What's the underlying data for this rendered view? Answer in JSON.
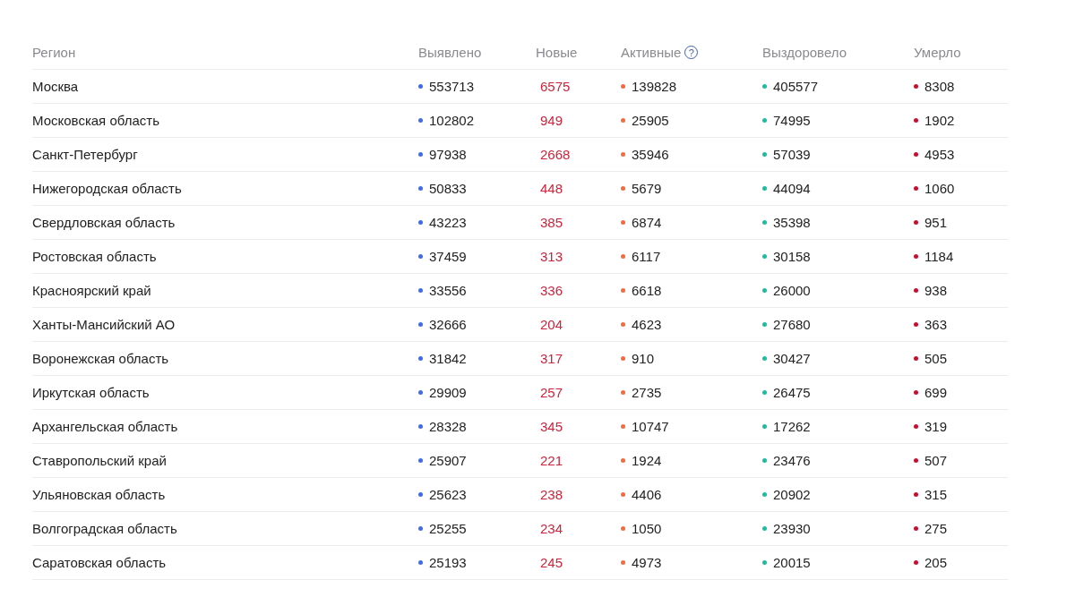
{
  "table": {
    "columns": [
      {
        "label": "Регион",
        "kind": "name"
      },
      {
        "label": "Выявлено",
        "kind": "dot",
        "color": "#3d6cf2"
      },
      {
        "label": "Новые",
        "kind": "new"
      },
      {
        "label": "Активные",
        "kind": "dot",
        "color": "#f36b3f",
        "help": "?"
      },
      {
        "label": "Выздоровело",
        "kind": "dot",
        "color": "#17bfa0"
      },
      {
        "label": "Умерло",
        "kind": "dot",
        "color": "#c8102e"
      }
    ],
    "rows": [
      [
        "Москва",
        "553713",
        "6575",
        "139828",
        "405577",
        "8308"
      ],
      [
        "Московская область",
        "102802",
        "949",
        "25905",
        "74995",
        "1902"
      ],
      [
        "Санкт-Петербург",
        "97938",
        "2668",
        "35946",
        "57039",
        "4953"
      ],
      [
        "Нижегородская область",
        "50833",
        "448",
        "5679",
        "44094",
        "1060"
      ],
      [
        "Свердловская область",
        "43223",
        "385",
        "6874",
        "35398",
        "951"
      ],
      [
        "Ростовская область",
        "37459",
        "313",
        "6117",
        "30158",
        "1184"
      ],
      [
        "Красноярский край",
        "33556",
        "336",
        "6618",
        "26000",
        "938"
      ],
      [
        "Ханты-Мансийский АО",
        "32666",
        "204",
        "4623",
        "27680",
        "363"
      ],
      [
        "Воронежская область",
        "31842",
        "317",
        "910",
        "30427",
        "505"
      ],
      [
        "Иркутская область",
        "29909",
        "257",
        "2735",
        "26475",
        "699"
      ],
      [
        "Архангельская область",
        "28328",
        "345",
        "10747",
        "17262",
        "319"
      ],
      [
        "Ставропольский край",
        "25907",
        "221",
        "1924",
        "23476",
        "507"
      ],
      [
        "Ульяновская область",
        "25623",
        "238",
        "4406",
        "20902",
        "315"
      ],
      [
        "Волгоградская область",
        "25255",
        "234",
        "1050",
        "23930",
        "275"
      ],
      [
        "Саратовская область",
        "25193",
        "245",
        "4973",
        "20015",
        "205"
      ]
    ]
  }
}
